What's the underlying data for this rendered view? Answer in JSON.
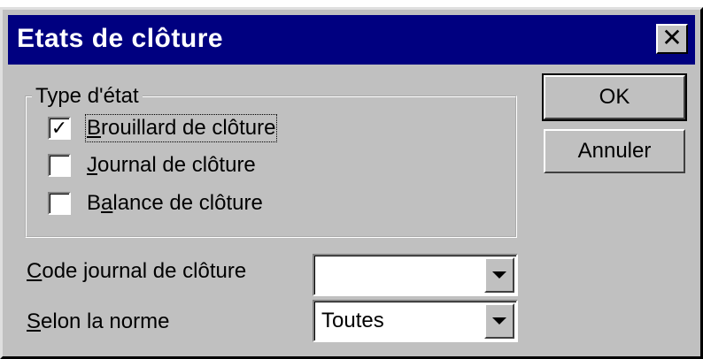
{
  "window": {
    "title": "Etats de clôture",
    "close_glyph": "✕",
    "colors": {
      "titlebar": "#000080",
      "face": "#c0c0c0"
    }
  },
  "group": {
    "legend": "Type d'état",
    "items": [
      {
        "label_prefix": "",
        "mnemonic": "B",
        "label_rest": "rouillard de clôture",
        "checked": true,
        "check_glyph": "✓"
      },
      {
        "label_prefix": "",
        "mnemonic": "J",
        "label_rest": "ournal de clôture",
        "checked": false,
        "check_glyph": ""
      },
      {
        "label_prefix": "B",
        "mnemonic": "a",
        "label_rest": "lance de clôture",
        "checked": false,
        "check_glyph": ""
      }
    ]
  },
  "buttons": {
    "ok": "OK",
    "cancel": "Annuler"
  },
  "fields": {
    "code_journal": {
      "mnemonic": "C",
      "label_rest": "ode journal de clôture",
      "value": ""
    },
    "norme": {
      "mnemonic": "S",
      "label_rest": "elon la norme",
      "value": "Toutes"
    }
  },
  "icons": [
    "close-icon",
    "check-icon",
    "dropdown-arrow-icon"
  ]
}
